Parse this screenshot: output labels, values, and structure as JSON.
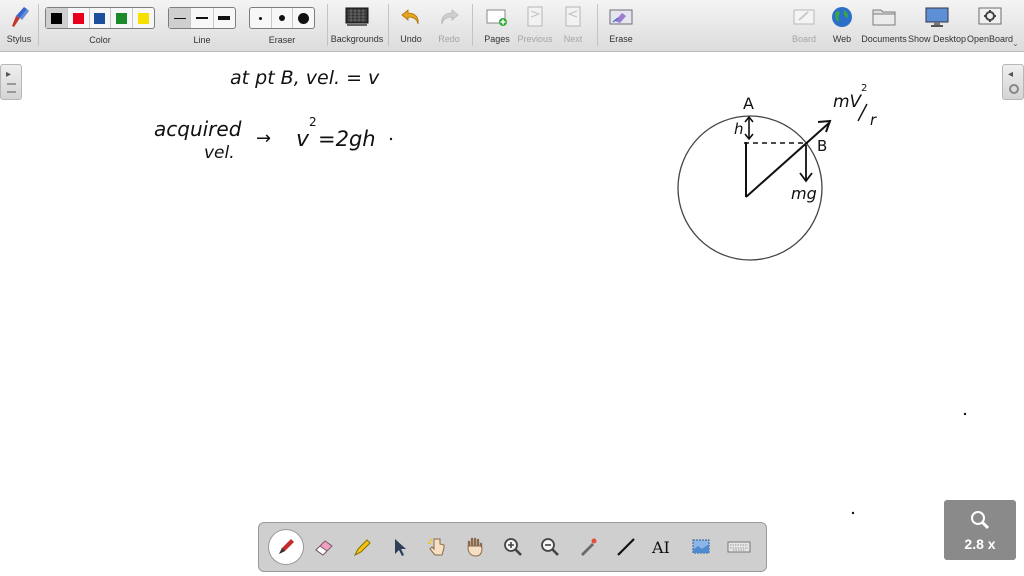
{
  "toolbar": {
    "stylus": "Stylus",
    "color": "Color",
    "line": "Line",
    "eraser": "Eraser",
    "backgrounds": "Backgrounds",
    "undo": "Undo",
    "redo": "Redo",
    "pages": "Pages",
    "previous": "Previous",
    "next": "Next",
    "erase": "Erase",
    "board": "Board",
    "web": "Web",
    "documents": "Documents",
    "show_desktop": "Show Desktop",
    "openboard": "OpenBoard",
    "colors": [
      "#000000",
      "#e8001c",
      "#1d4f9c",
      "#1a8a2a",
      "#f5e000"
    ]
  },
  "board": {
    "line1": "at pt B, vel. = v",
    "acquired": "acquired",
    "vel": "vel.",
    "arrow": "→",
    "v": "v",
    "v_sup": "2",
    "eq_rest": "=2gh",
    "label_A": "A",
    "label_h": "h",
    "label_B": "B",
    "label_mg": "mg",
    "label_mv": "mV",
    "label_mv_sup": "2",
    "label_r": "r"
  },
  "zoom": {
    "label": "2.8 x"
  }
}
